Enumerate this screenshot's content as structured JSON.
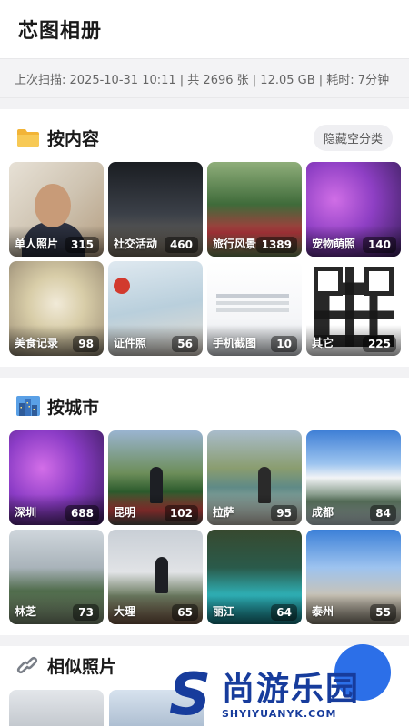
{
  "app": {
    "title": "芯图相册"
  },
  "status": {
    "text": "上次扫描: 2025-10-31 10:11 | 共 2696 张 | 12.05 GB | 耗时: 7分钟"
  },
  "by_content": {
    "title": "按内容",
    "toggle_label": "隐藏空分类",
    "icon": "folder-icon",
    "items": [
      {
        "label": "单人照片",
        "count": "315"
      },
      {
        "label": "社交活动",
        "count": "460"
      },
      {
        "label": "旅行风景",
        "count": "1389"
      },
      {
        "label": "宠物萌照",
        "count": "140"
      },
      {
        "label": "美食记录",
        "count": "98"
      },
      {
        "label": "证件照",
        "count": "56"
      },
      {
        "label": "手机截图",
        "count": "10"
      },
      {
        "label": "其它",
        "count": "225"
      }
    ]
  },
  "by_city": {
    "title": "按城市",
    "icon": "city-icon",
    "items": [
      {
        "label": "深圳",
        "count": "688"
      },
      {
        "label": "昆明",
        "count": "102"
      },
      {
        "label": "拉萨",
        "count": "95"
      },
      {
        "label": "成都",
        "count": "84"
      },
      {
        "label": "林芝",
        "count": "73"
      },
      {
        "label": "大理",
        "count": "65"
      },
      {
        "label": "丽江",
        "count": "64"
      },
      {
        "label": "泰州",
        "count": "55"
      }
    ]
  },
  "similar": {
    "title": "相似照片",
    "icon": "link-icon"
  },
  "watermark": {
    "main": "尚游乐园",
    "sub": "SHYIYUANYK.COM"
  },
  "colors": {
    "accent": "#2c6fe8",
    "watermark": "#173c9c"
  }
}
